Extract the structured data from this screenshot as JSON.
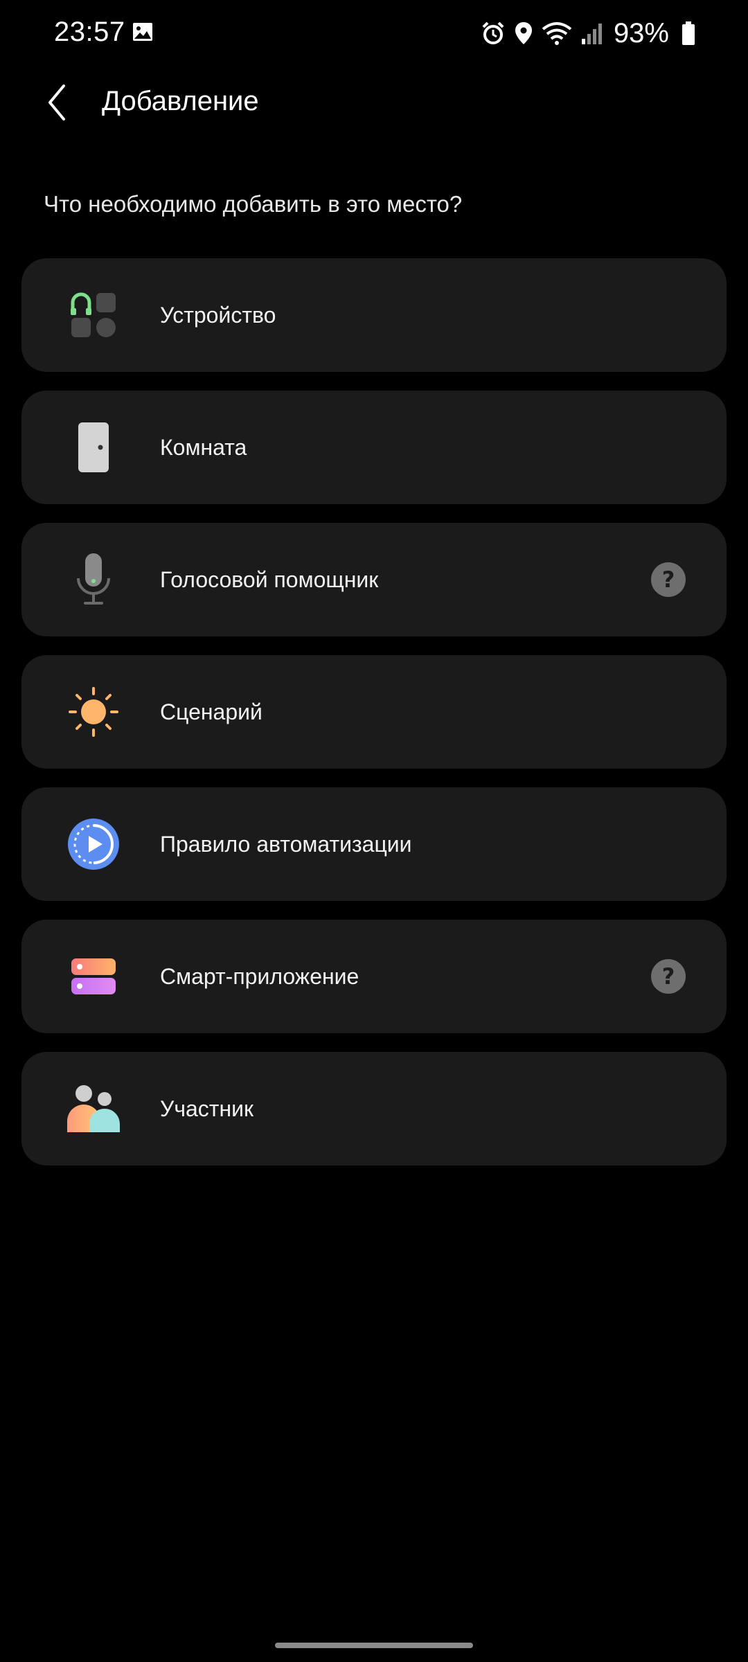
{
  "status_bar": {
    "time": "23:57",
    "battery_percent": "93%",
    "icons": [
      "gallery-icon",
      "alarm-icon",
      "location-icon",
      "wifi-icon",
      "signal-icon",
      "battery-icon"
    ]
  },
  "header": {
    "title": "Добавление",
    "back_icon": "chevron-left-icon"
  },
  "question": "Что необходимо добавить в это место?",
  "options": [
    {
      "label": "Устройство",
      "icon": "devices-icon",
      "has_help": false
    },
    {
      "label": "Комната",
      "icon": "door-icon",
      "has_help": false
    },
    {
      "label": "Голосовой помощник",
      "icon": "microphone-icon",
      "has_help": true
    },
    {
      "label": "Сценарий",
      "icon": "sun-icon",
      "has_help": false
    },
    {
      "label": "Правило автоматизации",
      "icon": "automation-play-icon",
      "has_help": false
    },
    {
      "label": "Смарт-приложение",
      "icon": "smartapp-icon",
      "has_help": true
    },
    {
      "label": "Участник",
      "icon": "members-icon",
      "has_help": false
    }
  ],
  "help_glyph": "?",
  "colors": {
    "background": "#000000",
    "card": "#1b1b1b",
    "help_badge": "#6e6e6e",
    "automation_blue": "#5b8ef0",
    "sun_orange": "#ffb56a",
    "device_green": "#7ee08a"
  }
}
